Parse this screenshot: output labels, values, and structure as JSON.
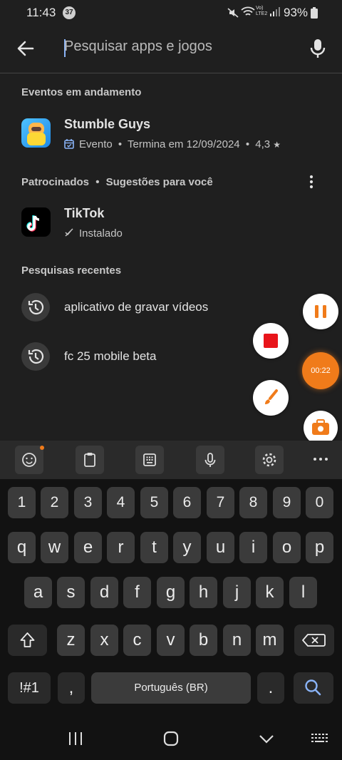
{
  "status": {
    "time": "11:43",
    "notif_count": "37",
    "network": "Vo) LTE2",
    "battery": "93%"
  },
  "search": {
    "placeholder": "Pesquisar apps e jogos"
  },
  "events": {
    "header": "Eventos em andamento",
    "app": {
      "name": "Stumble Guys",
      "tag": "Evento",
      "ends": "Termina em 12/09/2024",
      "rating": "4,3",
      "rating_star": "★"
    },
    "bullet": "•"
  },
  "sponsored": {
    "header": "Patrocinados",
    "sub": "Sugestões para você",
    "app": {
      "name": "TikTok",
      "status": "Instalado"
    }
  },
  "recent": {
    "header": "Pesquisas recentes",
    "items": [
      "aplicativo de gravar vídeos",
      "fc 25 mobile beta"
    ]
  },
  "recorder": {
    "timer": "00:22"
  },
  "keyboard": {
    "row_numbers": [
      "1",
      "2",
      "3",
      "4",
      "5",
      "6",
      "7",
      "8",
      "9",
      "0"
    ],
    "row1": [
      "q",
      "w",
      "e",
      "r",
      "t",
      "y",
      "u",
      "i",
      "o",
      "p"
    ],
    "row2": [
      "a",
      "s",
      "d",
      "f",
      "g",
      "h",
      "j",
      "k",
      "l"
    ],
    "row3": [
      "z",
      "x",
      "c",
      "v",
      "b",
      "n",
      "m"
    ],
    "symbols_key": "!#1",
    "comma_key": ",",
    "space_label": "Português (BR)",
    "period_key": "."
  },
  "colors": {
    "accent_blue": "#8ab4f8",
    "record_orange": "#f07b1a",
    "stop_red": "#e8141a"
  }
}
